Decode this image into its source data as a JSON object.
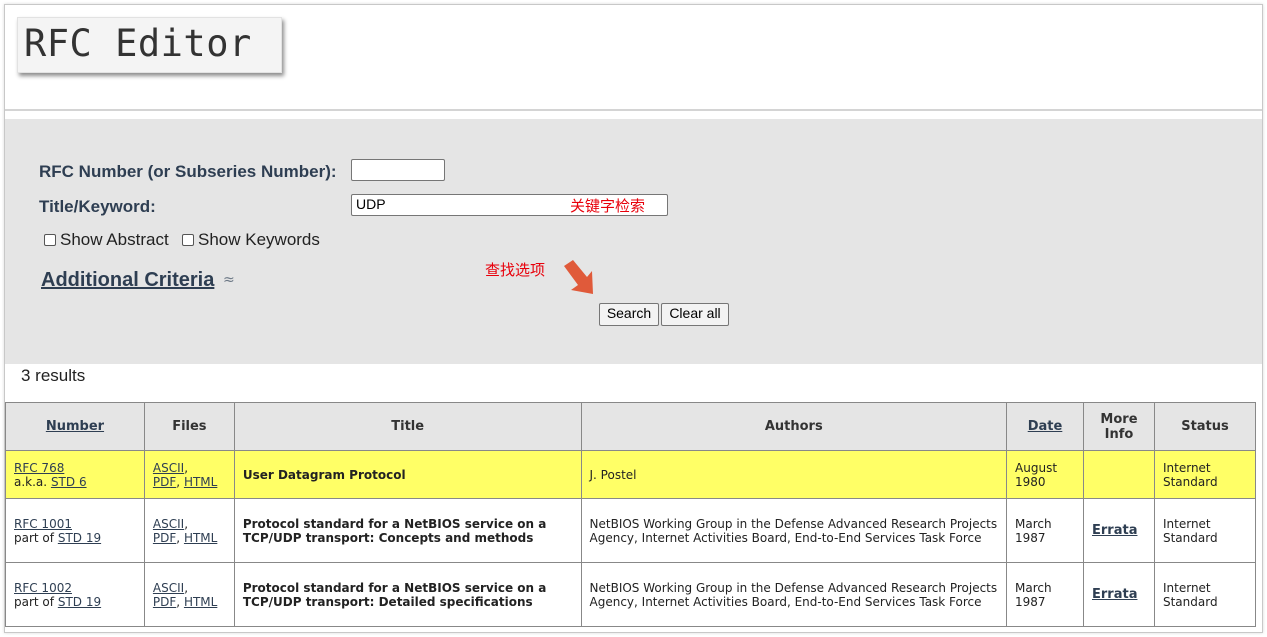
{
  "logo": {
    "text": "RFC Editor"
  },
  "search": {
    "rfc_number_label": "RFC Number (or Subseries Number):",
    "rfc_number_value": "",
    "title_label": "Title/Keyword:",
    "title_value": "UDP",
    "show_abstract_label": "Show Abstract",
    "show_keywords_label": "Show Keywords",
    "additional_criteria": "Additional Criteria ",
    "search_button": "Search",
    "clear_button": "Clear all"
  },
  "annotations": {
    "keyword_search": "关键字检索",
    "find_options": "查找选项",
    "annotation_color": "#e8000b"
  },
  "results": {
    "count_text": "3 results",
    "headers": {
      "number": "Number",
      "files": "Files",
      "title": "Title",
      "authors": "Authors",
      "date": "Date",
      "more_info": "More Info",
      "status": "Status"
    },
    "rows": [
      {
        "number": "RFC 768",
        "rel_prefix": "a.k.a.",
        "rel_link": "STD 6",
        "files": [
          "ASCII",
          "PDF",
          "HTML"
        ],
        "title": "User Datagram Protocol",
        "authors": "J. Postel",
        "date_month": "August",
        "date_year": "1980",
        "more_info": "",
        "status_1": "Internet",
        "status_2": "Standard"
      },
      {
        "number": "RFC 1001",
        "rel_prefix": "part of",
        "rel_link": "STD 19",
        "files": [
          "ASCII",
          "PDF",
          "HTML"
        ],
        "title": "Protocol standard for a NetBIOS service on a TCP/UDP transport: Concepts and methods",
        "authors": "NetBIOS Working Group in the Defense Advanced Research Projects Agency, Internet Activities Board, End-to-End Services Task Force",
        "date_month": "March",
        "date_year": "1987",
        "more_info": "Errata",
        "status_1": "Internet",
        "status_2": "Standard"
      },
      {
        "number": "RFC 1002",
        "rel_prefix": "part of",
        "rel_link": "STD 19",
        "files": [
          "ASCII",
          "PDF",
          "HTML"
        ],
        "title": "Protocol standard for a NetBIOS service on a TCP/UDP transport: Detailed specifications",
        "authors": "NetBIOS Working Group in the Defense Advanced Research Projects Agency, Internet Activities Board, End-to-End Services Task Force",
        "date_month": "March",
        "date_year": "1987",
        "more_info": "Errata",
        "status_1": "Internet",
        "status_2": "Standard"
      }
    ]
  },
  "colors": {
    "highlight_row": "#ffff66",
    "panel_bg": "#e5e5e5",
    "link": "#2e3e52"
  }
}
